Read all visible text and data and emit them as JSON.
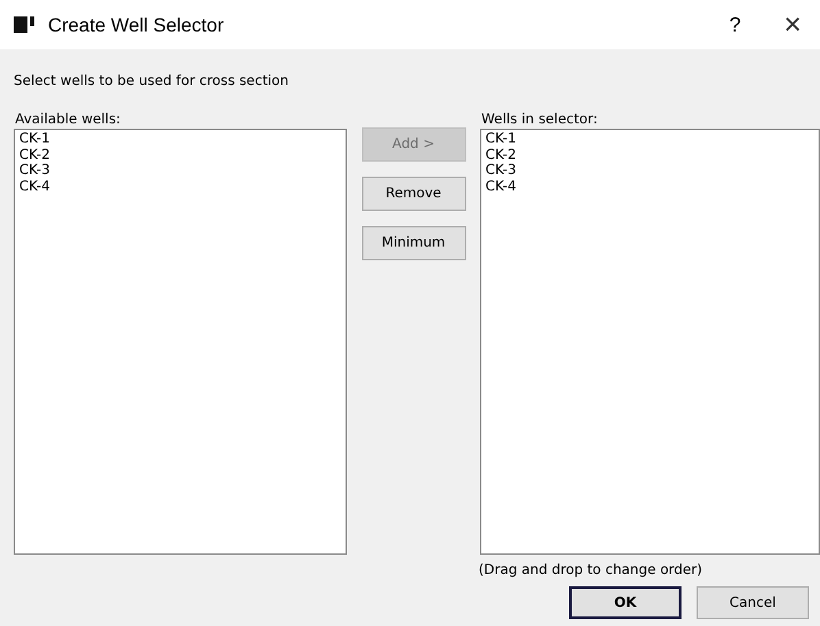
{
  "window": {
    "title": "Create Well Selector",
    "help": "?",
    "close": "×"
  },
  "instruction": "Select wells to be used for cross section",
  "available": {
    "label": "Available wells:",
    "items": [
      "CK-1",
      "CK-2",
      "CK-3",
      "CK-4"
    ]
  },
  "actions": [
    {
      "label": "Add >",
      "disabled": true
    },
    {
      "label": "Remove",
      "disabled": false
    },
    {
      "label": "Minimum",
      "disabled": false
    }
  ],
  "selector": {
    "label": "Wells in selector:",
    "items": [
      "CK-1",
      "CK-2",
      "CK-3",
      "CK-4"
    ]
  },
  "hint": "(Drag and drop to change order)",
  "buttons": [
    {
      "label": "OK",
      "default": true
    },
    {
      "label": "Cancel",
      "default": false
    }
  ]
}
